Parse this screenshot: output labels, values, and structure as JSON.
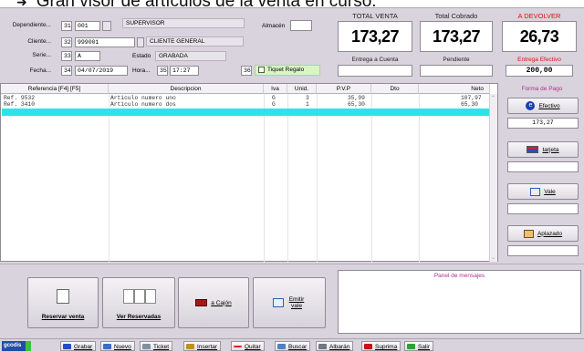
{
  "caption": {
    "text": "Gran visor de artículos de la venta en curso."
  },
  "header": {
    "dependiente_label": "Dependiente...",
    "dependiente_num": "31",
    "dependiente_code": "001",
    "dependiente_name": "SUPERVISOR",
    "almacen_label": "Almacén",
    "cliente_label": "Cliente...",
    "cliente_num": "32",
    "cliente_code": "999001",
    "cliente_name": "CLIENTE GENERAL",
    "serie_label": "Serie...",
    "serie_num": "33",
    "serie_value": "A",
    "estado_label": "Estado",
    "estado_value": "GRABADA",
    "fecha_label": "Fecha...",
    "fecha_num": "34",
    "fecha_value": "04/07/2019",
    "hora_label": "Hora...",
    "hora_num": "35",
    "hora_value": "17:27",
    "ticket_num": "36",
    "ticket_label": "Tiquet Regalo"
  },
  "totals": {
    "total_venta_label": "TOTAL VENTA",
    "total_venta": "173,27",
    "total_cobrado_label": "Total Cobrado",
    "total_cobrado": "173,27",
    "a_devolver_label": "A DEVOLVER",
    "a_devolver": "26,73",
    "entrega_cuenta_label": "Entrega a Cuenta",
    "pendiente_label": "Pendiente",
    "entrega_efectivo_label": "Entrega Efectivo",
    "entrega_efectivo": "200,00",
    "colors": {
      "devolver": "#e01010",
      "panel_title": "#b03090"
    }
  },
  "grid": {
    "columns": [
      "Referencia [F4] [F5]",
      "Descripcion",
      "Iva",
      "Unid.",
      "P.V.P",
      "Dto",
      "Neto"
    ],
    "rows": [
      [
        "Ref. 9532",
        "Articulo numero uno",
        "G",
        "3",
        "35,99",
        "",
        "107,97"
      ],
      [
        "Ref. 3410",
        "Articulo numero dos",
        "G",
        "1",
        "65,30",
        "",
        "65,30"
      ]
    ]
  },
  "payment": {
    "title": "Forma de Pago",
    "efectivo_label": "Efectivo",
    "efectivo_value": "173,27",
    "tarjeta_label": "tarjeta",
    "vale_label": "Vale",
    "aplazado_label": "Aplazado"
  },
  "bottom": {
    "reservar_label": "Reservar venta",
    "ver_reservadas_label": "Ver Reservadas",
    "a_cajon_label": "a Cajón",
    "emitir_vale_label": "Emitir vale",
    "mensajes_title": "Panel de mensajes"
  },
  "taskbar": {
    "logo": "gcodis",
    "grabar": "Grabar",
    "nuevo": "Nuevo",
    "ticket": "Ticket",
    "insertar": "Insertar",
    "quitar": "Quitar",
    "buscar": "Buscar",
    "albaran": "Albarán",
    "suprima": "Suprima",
    "salir": "Salir"
  }
}
